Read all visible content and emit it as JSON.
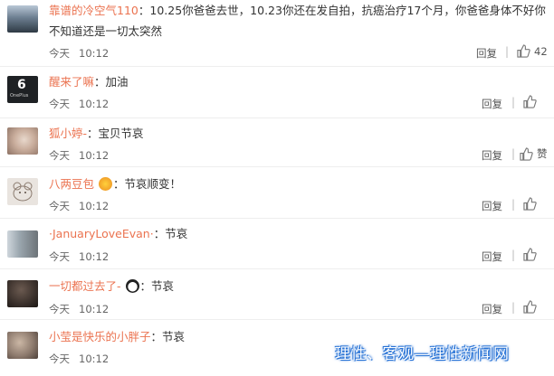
{
  "comments": [
    {
      "username": "靠谱的冷空气110",
      "text": "10.25你爸爸去世，10.23你还在发自拍，抗癌治疗17个月，你爸爸身体不好你",
      "text2": "不知道还是一切太突然",
      "day": "今天",
      "time": "10:12",
      "reply": "回复",
      "likes": "42"
    },
    {
      "username": "醒来了嘛",
      "text": "加油",
      "day": "今天",
      "time": "10:12",
      "reply": "回复"
    },
    {
      "username": "狐小婷-",
      "text": "宝贝节哀",
      "day": "今天",
      "time": "10:12",
      "reply": "回复",
      "likes": "赞"
    },
    {
      "username": "八两豆包",
      "text": "节哀顺变！",
      "day": "今天",
      "time": "10:12",
      "reply": "回复"
    },
    {
      "username": "·JanuaryLoveEvan·",
      "text": "节哀",
      "day": "今天",
      "time": "10:12",
      "reply": "回复"
    },
    {
      "username": "一切都过去了-",
      "text": "节哀",
      "day": "今天",
      "time": "10:12",
      "reply": "回复"
    },
    {
      "username": "小莹是快乐的小胖子",
      "text": "节哀",
      "day": "今天",
      "time": "10:12",
      "reply": "回复"
    }
  ],
  "avatars": [
    "scenery-avatar",
    "oneplus-avatar",
    "portrait-avatar",
    "cartoon-avatar",
    "girl-avatar",
    "portrait-avatar",
    "portrait-avatar"
  ],
  "avatar_text": {
    "oneplus": "6",
    "oneplus_sub": "OnePlus"
  },
  "watermark": "理性、客观—理性新闻网",
  "colors": {
    "username": "#eb7350",
    "text": "#333333",
    "meta": "#666666",
    "watermark_glow": "#2a74d6"
  }
}
